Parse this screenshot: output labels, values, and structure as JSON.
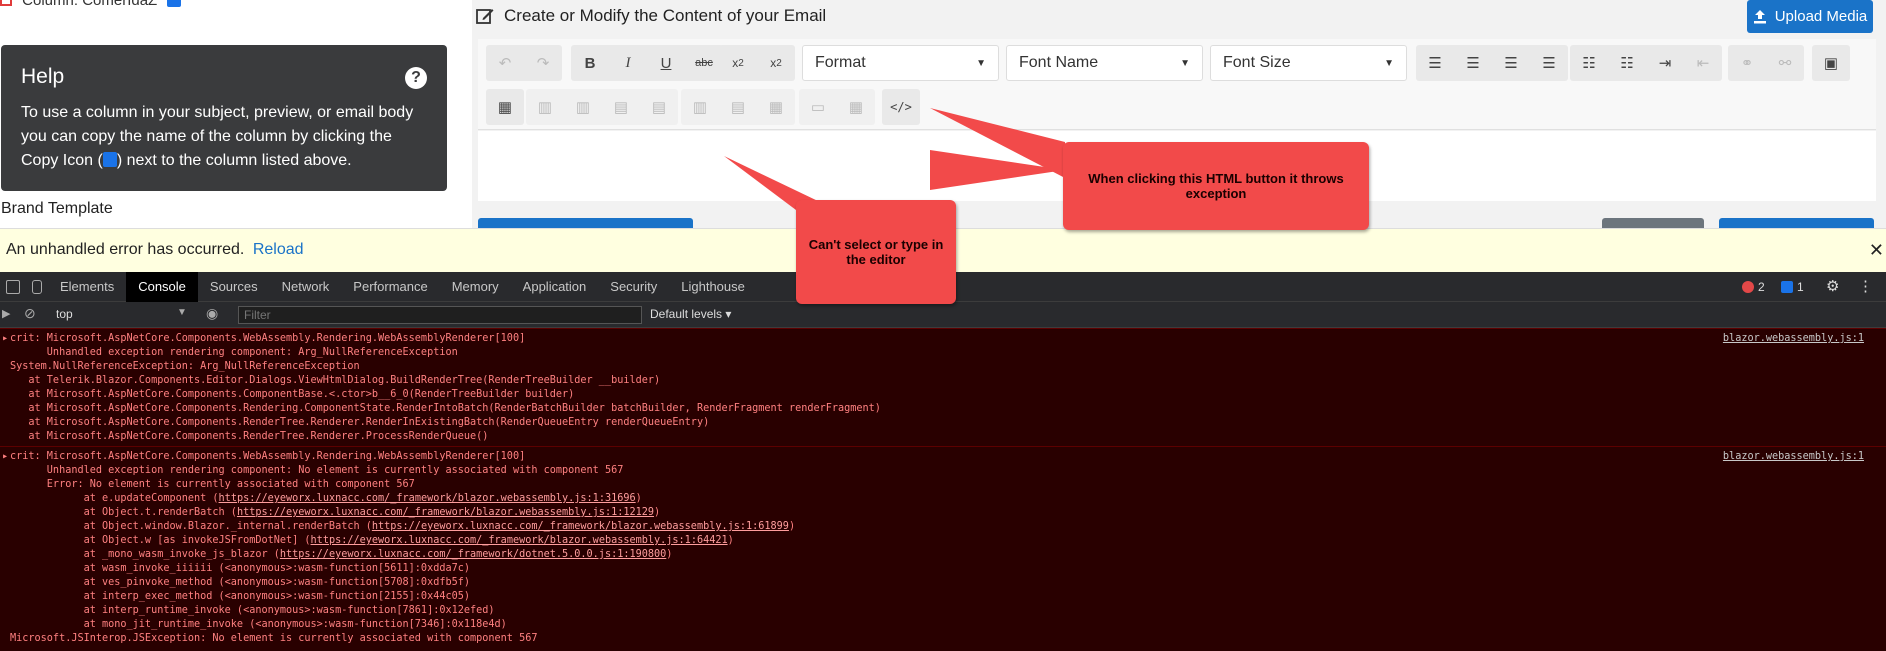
{
  "left_panel": {
    "column_remnant": "Column: ComerIdaZ",
    "help": {
      "title": "Help",
      "text_1": "To use a column in your subject, preview, or email body you can copy the name of the column by clicking the Copy Icon (",
      "text_2": ") next to the column listed above."
    },
    "brand_template": "Brand Template"
  },
  "editor": {
    "heading": "Create or Modify the Content of your Email",
    "upload_label": "Upload Media",
    "format_label": "Format",
    "font_name_label": "Font Name",
    "font_size_label": "Font Size"
  },
  "error_bar": {
    "message": "An unhandled error has occurred.",
    "reload": "Reload",
    "close": "✕"
  },
  "devtools": {
    "tabs": [
      "Elements",
      "Console",
      "Sources",
      "Network",
      "Performance",
      "Memory",
      "Application",
      "Security",
      "Lighthouse"
    ],
    "active_tab": "Console",
    "error_count": "2",
    "message_count": "1",
    "context": "top",
    "filter_placeholder": "Filter",
    "levels": "Default levels"
  },
  "console": {
    "msg1": {
      "source": "blazor.webassembly.js:1",
      "lines": [
        "crit: Microsoft.AspNetCore.Components.WebAssembly.Rendering.WebAssemblyRenderer[100]",
        "      Unhandled exception rendering component: Arg_NullReferenceException",
        "System.NullReferenceException: Arg_NullReferenceException",
        "   at Telerik.Blazor.Components.Editor.Dialogs.ViewHtmlDialog.BuildRenderTree(RenderTreeBuilder __builder)",
        "   at Microsoft.AspNetCore.Components.ComponentBase.<.ctor>b__6_0(RenderTreeBuilder builder)",
        "   at Microsoft.AspNetCore.Components.Rendering.ComponentState.RenderIntoBatch(RenderBatchBuilder batchBuilder, RenderFragment renderFragment)",
        "   at Microsoft.AspNetCore.Components.RenderTree.Renderer.RenderInExistingBatch(RenderQueueEntry renderQueueEntry)",
        "   at Microsoft.AspNetCore.Components.RenderTree.Renderer.ProcessRenderQueue()"
      ]
    },
    "msg2": {
      "source": "blazor.webassembly.js:1",
      "head": [
        "crit: Microsoft.AspNetCore.Components.WebAssembly.Rendering.WebAssemblyRenderer[100]",
        "      Unhandled exception rendering component: No element is currently associated with component 567",
        "      Error: No element is currently associated with component 567"
      ],
      "stack": [
        {
          "pre": "            at e.updateComponent (",
          "url": "https://eyeworx.luxnacc.com/_framework/blazor.webassembly.js:1:31696",
          "post": ")"
        },
        {
          "pre": "            at Object.t.renderBatch (",
          "url": "https://eyeworx.luxnacc.com/_framework/blazor.webassembly.js:1:12129",
          "post": ")"
        },
        {
          "pre": "            at Object.window.Blazor._internal.renderBatch (",
          "url": "https://eyeworx.luxnacc.com/_framework/blazor.webassembly.js:1:61899",
          "post": ")"
        },
        {
          "pre": "            at Object.w [as invokeJSFromDotNet] (",
          "url": "https://eyeworx.luxnacc.com/_framework/blazor.webassembly.js:1:64421",
          "post": ")"
        },
        {
          "pre": "            at _mono_wasm_invoke_js_blazor (",
          "url": "https://eyeworx.luxnacc.com/_framework/dotnet.5.0.0.js:1:190800",
          "post": ")"
        }
      ],
      "tail": [
        "            at wasm_invoke_iiiiii (<anonymous>:wasm-function[5611]:0xdda7c)",
        "            at ves_pinvoke_method (<anonymous>:wasm-function[5708]:0xdfb5f)",
        "            at interp_exec_method (<anonymous>:wasm-function[2155]:0x44c05)",
        "            at interp_runtime_invoke (<anonymous>:wasm-function[7861]:0x12efed)",
        "            at mono_jit_runtime_invoke (<anonymous>:wasm-function[7346]:0x118e4d)",
        "Microsoft.JSInterop.JSException: No element is currently associated with component 567"
      ]
    }
  },
  "callouts": {
    "html_button": "When clicking this HTML button it throws exception",
    "editor": "Can't select or type in the editor"
  },
  "colors": {
    "callout": "#f24a4a",
    "accent": "#1a73c8",
    "console_error_bg": "#290000",
    "console_error_text": "#ff8080"
  }
}
